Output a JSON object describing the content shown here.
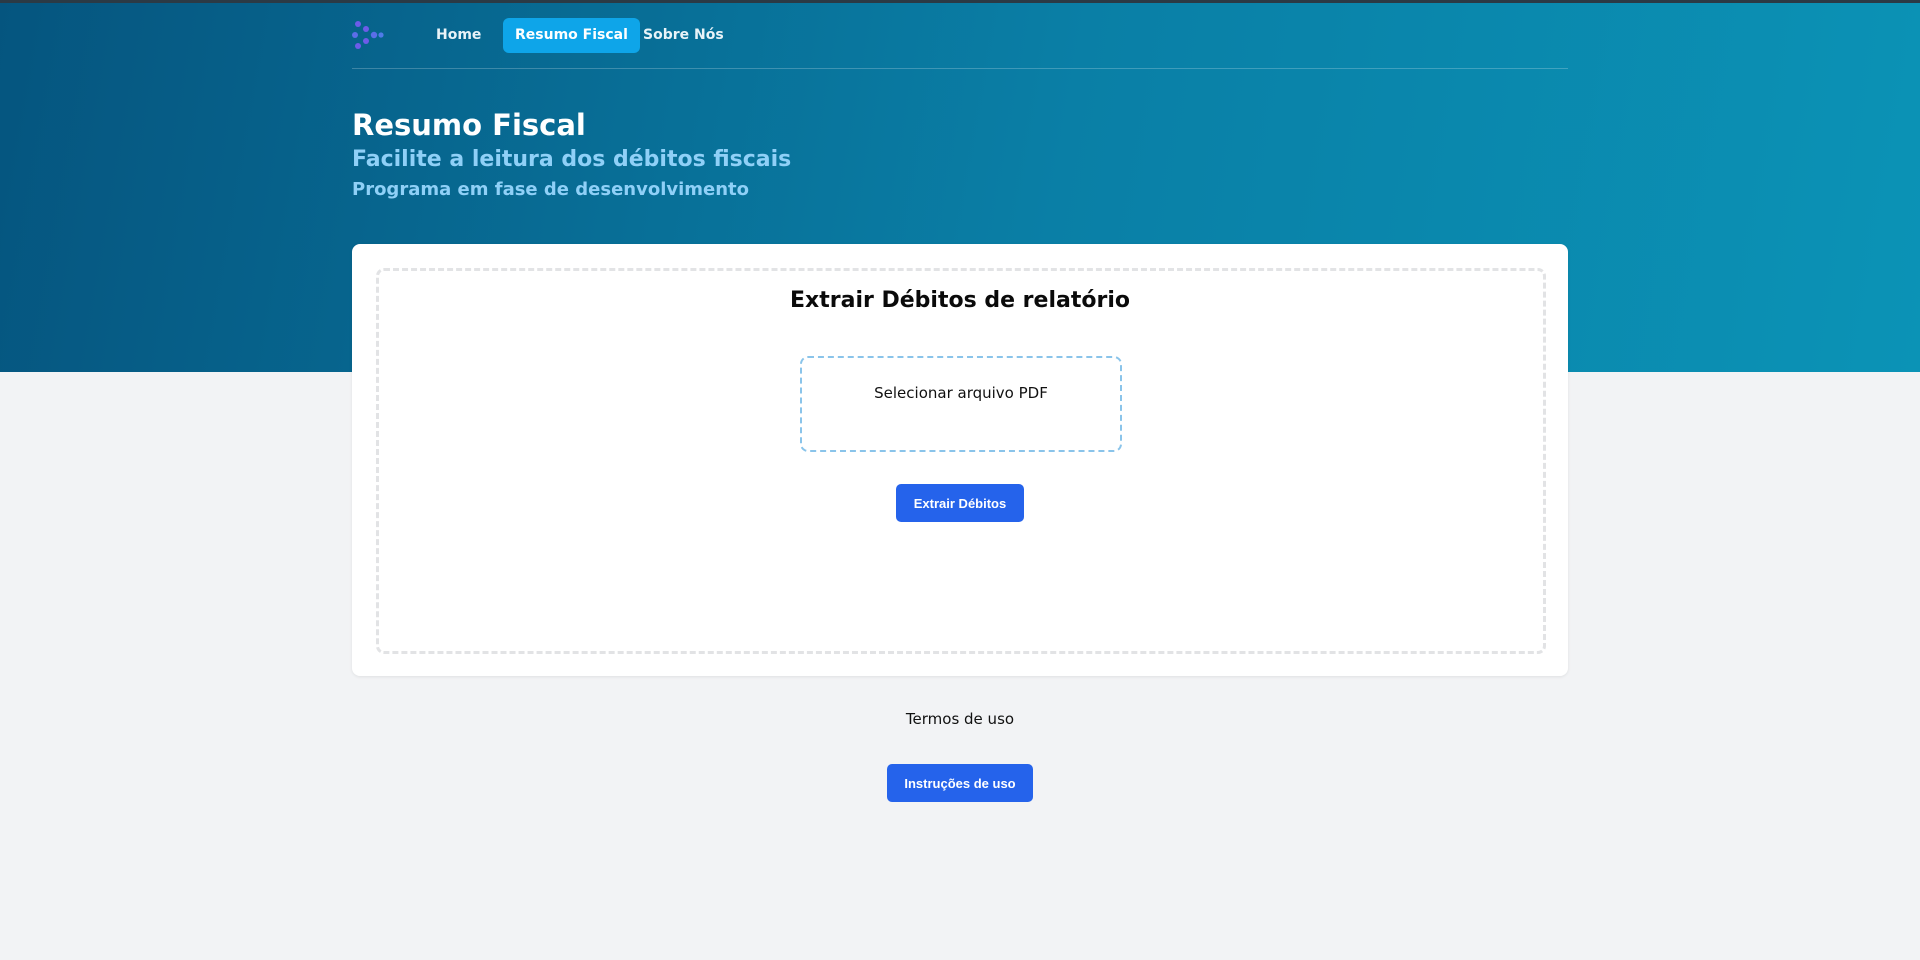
{
  "colors": {
    "hero_start": "#05557f",
    "hero_end": "#0b93b6",
    "nav_active": "#0ea5e9",
    "primary_button": "#2563eb",
    "subtitle": "#8fd0f7",
    "page_background": "#f2f3f5"
  },
  "nav": {
    "logo_icon": "molecule-logo-icon",
    "links": [
      {
        "label": "Home",
        "active": false
      },
      {
        "label": "Resumo Fiscal",
        "active": true
      },
      {
        "label": "Sobre Nós",
        "active": false
      }
    ]
  },
  "header": {
    "title": "Resumo Fiscal",
    "subtitle": "Facilite a leitura dos débitos fiscais",
    "note": "Programa em fase de desenvolvimento"
  },
  "card": {
    "title": "Extrair Débitos de relatório",
    "file_picker_label": "Selecionar arquivo PDF",
    "extract_button": "Extrair Débitos"
  },
  "footer": {
    "terms_label": "Termos de uso",
    "instructions_button": "Instruções de uso"
  }
}
